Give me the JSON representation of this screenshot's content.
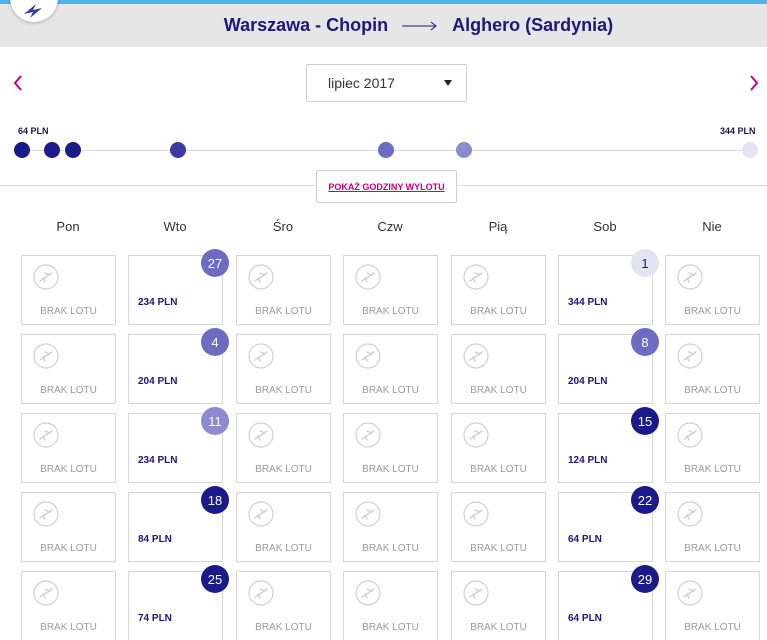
{
  "header": {
    "origin": "Warszawa - Chopin",
    "destination": "Alghero (Sardynia)"
  },
  "month_select": {
    "value": "lipiec 2017"
  },
  "price_scale": {
    "min_label": "64 PLN",
    "max_label": "344 PLN"
  },
  "show_times_label": "POKAŻ GODZINY WYLOTU",
  "no_flight_label": "BRAK LOTU",
  "weekdays": [
    "Pon",
    "Wto",
    "Śro",
    "Czw",
    "Pią",
    "Sob",
    "Nie"
  ],
  "colors": {
    "accent": "#c6007e",
    "navy": "#1e1679",
    "level_1": "#1a1a8a",
    "level_2": "#3b3aa0",
    "level_3": "#6e6cc2",
    "level_4": "#8d8ad0",
    "level_5": "#e3e3f4"
  },
  "price_dots": [
    {
      "price": 64
    },
    {
      "price": 74
    },
    {
      "price": 84
    },
    {
      "price": 124
    },
    {
      "price": 204
    },
    {
      "price": 234
    },
    {
      "price": 344
    }
  ],
  "flights": [
    {
      "day": "27",
      "price": "234 PLN"
    },
    {
      "day": "1",
      "price": "344 PLN"
    },
    {
      "day": "4",
      "price": "204 PLN"
    },
    {
      "day": "8",
      "price": "204 PLN"
    },
    {
      "day": "11",
      "price": "234 PLN"
    },
    {
      "day": "15",
      "price": "124 PLN"
    },
    {
      "day": "18",
      "price": "84 PLN"
    },
    {
      "day": "22",
      "price": "64 PLN"
    },
    {
      "day": "25",
      "price": "74 PLN"
    },
    {
      "day": "29",
      "price": "64 PLN"
    }
  ]
}
